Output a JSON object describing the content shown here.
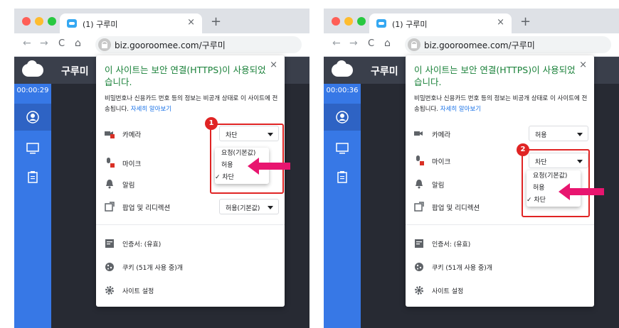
{
  "panels": [
    {
      "tab_title": "(1) 구루미",
      "tab_close": "×",
      "new_tab": "+",
      "nav_back": "←",
      "nav_forward": "→",
      "nav_reload": "C",
      "nav_home": "⌂",
      "url": "biz.gooroomee.com/구루미",
      "app_title": "구루미",
      "timer": "00:00:29",
      "popup": {
        "close": "×",
        "title": "이 사이트는 보안 연결(HTTPS)이 사용되었습니다.",
        "description": "비밀번호나 신용카드 번호 등의 정보는 비공개 상태로 이 사이트에 전송됩니다.",
        "learn_more": "자세히 알아보기",
        "permissions": [
          {
            "label": "카메라",
            "value": "차단"
          },
          {
            "label": "마이크",
            "value": ""
          },
          {
            "label": "알림",
            "value": ""
          },
          {
            "label": "팝업 및 리디렉션",
            "value": "허용(기본값)"
          }
        ],
        "certificate": "인증서: (유효)",
        "cookies": "쿠키 (51개 사용 중)개",
        "site_settings": "사이트 설정"
      },
      "dropdown": {
        "options": [
          "요청(기본값)",
          "허용",
          "✓ 차단"
        ],
        "highlight": "허용"
      },
      "step": "1"
    },
    {
      "tab_title": "(1) 구루미",
      "tab_close": "×",
      "new_tab": "+",
      "nav_back": "←",
      "nav_forward": "→",
      "nav_reload": "C",
      "nav_home": "⌂",
      "url": "biz.gooroomee.com/구루미",
      "app_title": "구루미",
      "timer": "00:00:36",
      "popup": {
        "close": "×",
        "title": "이 사이트는 보안 연결(HTTPS)이 사용되었습니다.",
        "description": "비밀번호나 신용카드 번호 등의 정보는 비공개 상태로 이 사이트에 전송됩니다.",
        "learn_more": "자세히 알아보기",
        "permissions": [
          {
            "label": "카메라",
            "value": "허용"
          },
          {
            "label": "마이크",
            "value": "차단"
          },
          {
            "label": "알림",
            "value": ""
          },
          {
            "label": "팝업 및 리디렉션",
            "value": ""
          }
        ],
        "certificate": "인증서: (유효)",
        "cookies": "쿠키 (51개 사용 중)개",
        "site_settings": "사이트 설정"
      },
      "dropdown": {
        "options": [
          "요청(기본값)",
          "허용",
          "✓ 차단"
        ],
        "highlight": "허용"
      },
      "step": "2"
    }
  ],
  "colors": {
    "sidebar": "#3778e6",
    "appbar": "#3a3f4b",
    "content": "#272a33",
    "highlight": "#e02424",
    "arrow": "#e8156f",
    "secure_title": "#188038",
    "link": "#1a73e8"
  }
}
